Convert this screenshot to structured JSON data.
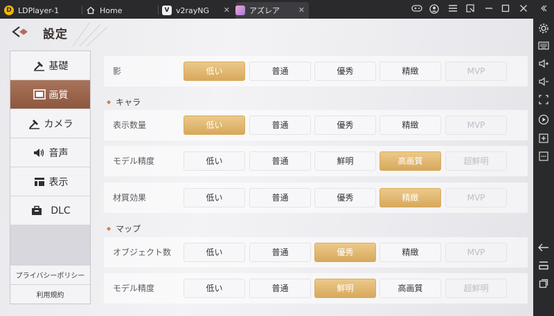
{
  "window": {
    "tabs": [
      {
        "label": "LDPlayer-1"
      },
      {
        "label": "Home"
      },
      {
        "label": "v2rayNG"
      },
      {
        "label": "アズレア"
      }
    ]
  },
  "header": {
    "title": "設定"
  },
  "nav": {
    "items": [
      {
        "label": "基礎"
      },
      {
        "label": "画質"
      },
      {
        "label": "カメラ"
      },
      {
        "label": "音声"
      },
      {
        "label": "表示"
      },
      {
        "label": "DLC"
      }
    ],
    "active_index": 1,
    "privacy": "プライバシーポリシー",
    "terms": "利用規約"
  },
  "settings": {
    "shadow": {
      "label": "影",
      "options": [
        "低い",
        "普通",
        "優秀",
        "精緻",
        "MVP"
      ],
      "selected": "低い",
      "disabled": [
        "MVP"
      ]
    },
    "section_character": "キャラ",
    "display_count": {
      "label": "表示数量",
      "options": [
        "低い",
        "普通",
        "優秀",
        "精緻",
        "MVP"
      ],
      "selected": "低い",
      "disabled": [
        "MVP"
      ]
    },
    "model_precision": {
      "label": "モデル精度",
      "options": [
        "低い",
        "普通",
        "鮮明",
        "高画質",
        "超鮮明"
      ],
      "selected": "高画質",
      "disabled": [
        "超鮮明"
      ]
    },
    "material_effect": {
      "label": "材質効果",
      "options": [
        "低い",
        "普通",
        "優秀",
        "精緻",
        "MVP"
      ],
      "selected": "精緻",
      "disabled": [
        "MVP"
      ]
    },
    "section_map": "マップ",
    "object_count": {
      "label": "オブジェクト数",
      "options": [
        "低い",
        "普通",
        "優秀",
        "精緻",
        "MVP"
      ],
      "selected": "優秀",
      "disabled": [
        "MVP"
      ]
    },
    "map_model_precision": {
      "label": "モデル精度",
      "options": [
        "低い",
        "普通",
        "鮮明",
        "高画質",
        "超鮮明"
      ],
      "selected": "鮮明",
      "disabled": [
        "超鮮明"
      ]
    }
  },
  "colors": {
    "accent_selected": "#d7a95c",
    "nav_active": "#8d573f"
  }
}
